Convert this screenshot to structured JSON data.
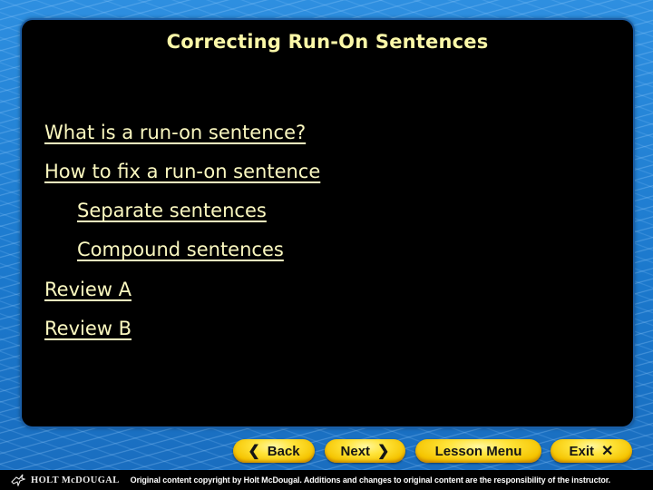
{
  "slide": {
    "title": "Correcting Run-On Sentences",
    "menu_items": [
      {
        "label": "What is a run-on sentence?",
        "level": 1
      },
      {
        "label": "How to fix a run-on sentence",
        "level": 1
      },
      {
        "label": "Separate sentences",
        "level": 2
      },
      {
        "label": "Compound sentences",
        "level": 2
      },
      {
        "label": "Review A",
        "level": 1
      },
      {
        "label": "Review B",
        "level": 1
      }
    ]
  },
  "nav": {
    "back": {
      "label": "Back",
      "icon": "chevron-left-icon",
      "glyph": "❮"
    },
    "next": {
      "label": "Next",
      "icon": "chevron-right-icon",
      "glyph": "❯"
    },
    "lesson_menu": {
      "label": "Lesson Menu"
    },
    "exit": {
      "label": "Exit",
      "icon": "close-icon",
      "glyph": "✕"
    }
  },
  "footer": {
    "brand": "HOLT McDOUGAL",
    "copyright": "Original content copyright by Holt McDougal.  Additions and changes to original content are the responsibility of the instructor."
  },
  "colors": {
    "title": "#fbf8a8",
    "link": "#fbf8c0",
    "panel": "#000000",
    "background": "#1f7fd0",
    "button": "#ffe43a"
  }
}
